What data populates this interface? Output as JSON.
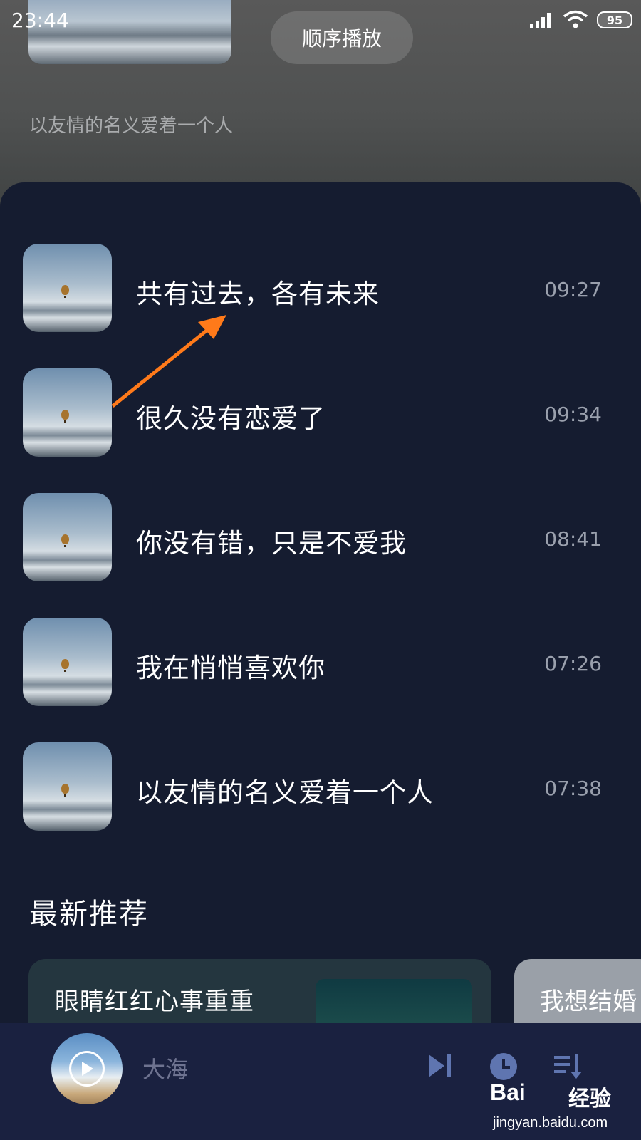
{
  "status_bar": {
    "time": "23:44",
    "battery": "95"
  },
  "header": {
    "play_mode_label": "顺序播放",
    "subtitle": "以友情的名义爱着一个人"
  },
  "songs": [
    {
      "title": "共有过去，各有未来",
      "duration": "09:27"
    },
    {
      "title": "很久没有恋爱了",
      "duration": "09:34"
    },
    {
      "title": "你没有错，只是不爱我",
      "duration": "08:41"
    },
    {
      "title": "我在悄悄喜欢你",
      "duration": "07:26"
    },
    {
      "title": "以友情的名义爱着一个人",
      "duration": "07:38"
    }
  ],
  "recommend": {
    "section_title": "最新推荐",
    "cards": [
      {
        "title": "眼睛红红心事重重"
      },
      {
        "title": "我想结婚"
      }
    ]
  },
  "player": {
    "current_song": "大海"
  },
  "annotation": {
    "arrow_color": "#ff7a1a"
  },
  "watermark": {
    "brand": "Bai",
    "brand_cn": "经验",
    "url": "jingyan.baidu.com"
  }
}
